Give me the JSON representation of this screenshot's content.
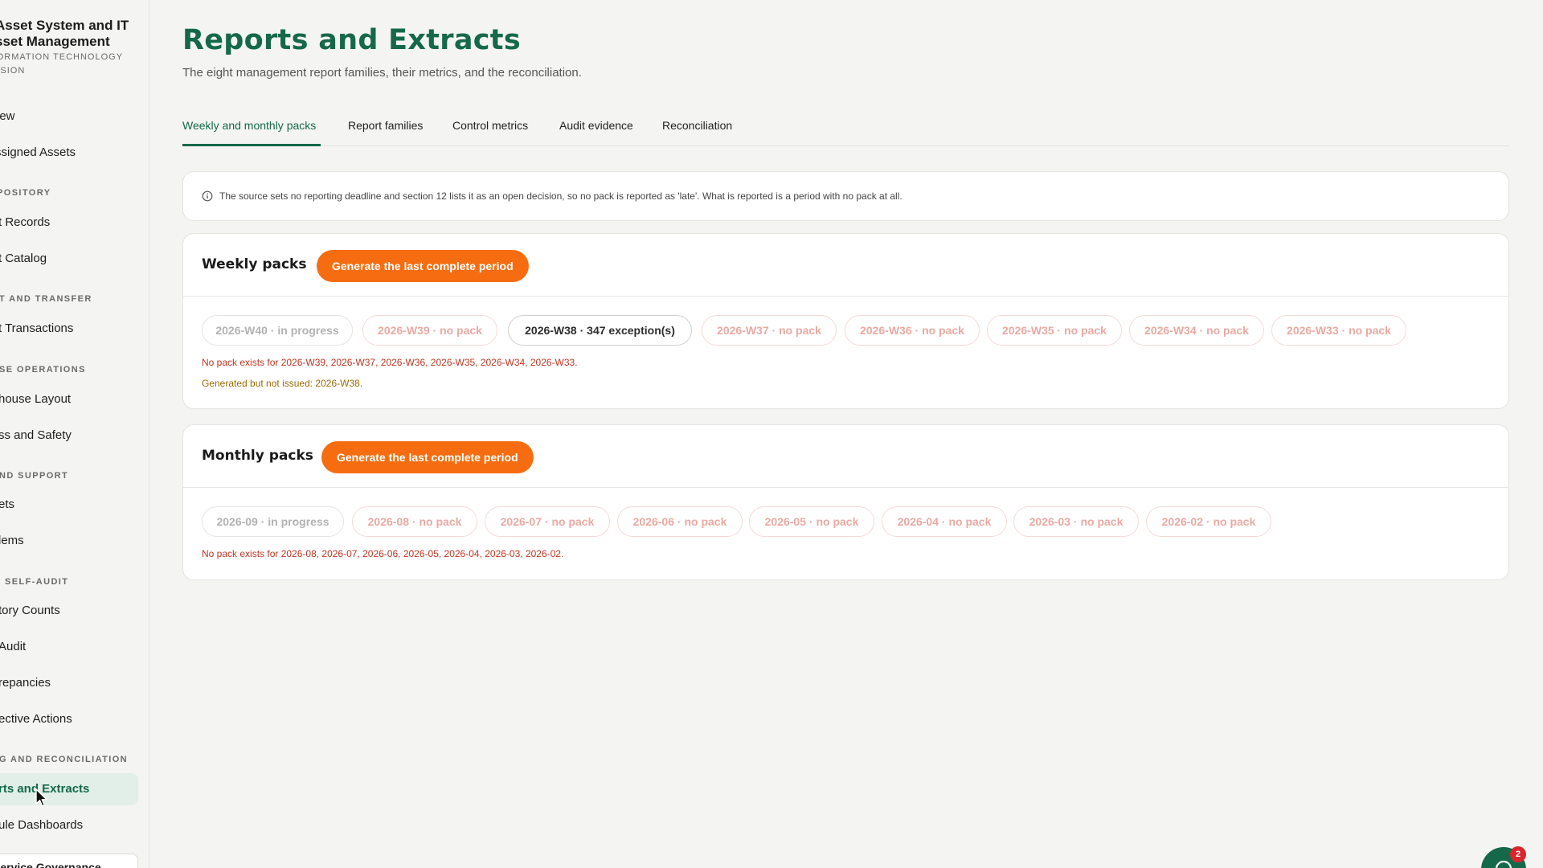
{
  "sidebar": {
    "app_title_line1": "Asset System and IT",
    "app_title_line2": "sset Management",
    "app_subtitle_line1": "FORMATION TECHNOLOGY",
    "app_subtitle_line2": "VISION",
    "items": [
      {
        "label": "iew"
      },
      {
        "label": "ssigned Assets"
      },
      {
        "label": "t Records"
      },
      {
        "label": "t Catalog"
      },
      {
        "label": "t Transactions"
      },
      {
        "label": "house Layout"
      },
      {
        "label": "ss and Safety"
      },
      {
        "label": "ets"
      },
      {
        "label": "lems"
      },
      {
        "label": "tory Counts"
      },
      {
        "label": "Audit"
      },
      {
        "label": "repancies"
      },
      {
        "label": "ective Actions"
      },
      {
        "label": "rts and Extracts"
      },
      {
        "label": "ule Dashboards"
      }
    ],
    "sections": [
      {
        "label": "POSITORY"
      },
      {
        "label": "T AND TRANSFER"
      },
      {
        "label": "SE OPERATIONS"
      },
      {
        "label": "ND SUPPORT"
      },
      {
        "label": "SELF-AUDIT"
      },
      {
        "label": "G AND RECONCILIATION"
      }
    ],
    "footer_label": "Service Governance"
  },
  "header": {
    "title": "Reports and Extracts",
    "subtitle": "The eight management report families, their metrics, and the reconciliation."
  },
  "tabs": [
    {
      "label": "Weekly and monthly packs"
    },
    {
      "label": "Report families"
    },
    {
      "label": "Control metrics"
    },
    {
      "label": "Audit evidence"
    },
    {
      "label": "Reconciliation"
    }
  ],
  "notice": {
    "text": "The source sets no reporting deadline and section 12 lists it as an open decision, so no pack is reported as 'late'. What is reported is a period with no pack at all."
  },
  "weekly": {
    "title": "Weekly packs",
    "button_label": "Generate the last complete period",
    "chips": [
      {
        "label": "2026-W40 · in progress",
        "status": "progress"
      },
      {
        "label": "2026-W39 · no pack",
        "status": "nopack"
      },
      {
        "label": "2026-W38 · 347 exception(s)",
        "status": "exception"
      },
      {
        "label": "2026-W37 · no pack",
        "status": "nopack"
      },
      {
        "label": "2026-W36 · no pack",
        "status": "nopack"
      },
      {
        "label": "2026-W35 · no pack",
        "status": "nopack"
      },
      {
        "label": "2026-W34 · no pack",
        "status": "nopack"
      },
      {
        "label": "2026-W33 · no pack",
        "status": "nopack"
      }
    ],
    "missing_message": "No pack exists for 2026-W39, 2026-W37, 2026-W36, 2026-W35, 2026-W34, 2026-W33.",
    "not_issued_message": "Generated but not issued: 2026-W38."
  },
  "monthly": {
    "title": "Monthly packs",
    "button_label": "Generate the last complete period",
    "chips": [
      {
        "label": "2026-09 · in progress",
        "status": "progress"
      },
      {
        "label": "2026-08 · no pack",
        "status": "nopack"
      },
      {
        "label": "2026-07 · no pack",
        "status": "nopack"
      },
      {
        "label": "2026-06 · no pack",
        "status": "nopack"
      },
      {
        "label": "2026-05 · no pack",
        "status": "nopack"
      },
      {
        "label": "2026-04 · no pack",
        "status": "nopack"
      },
      {
        "label": "2026-03 · no pack",
        "status": "nopack"
      },
      {
        "label": "2026-02 · no pack",
        "status": "nopack"
      }
    ],
    "missing_message": "No pack exists for 2026-08, 2026-07, 2026-06, 2026-05, 2026-04, 2026-03, 2026-02."
  },
  "chat_badge": "2",
  "colors": {
    "brand_green": "#15694a",
    "accent_orange": "#f56d10",
    "error_red": "#c23520",
    "warning_amber": "#9a6a00"
  }
}
